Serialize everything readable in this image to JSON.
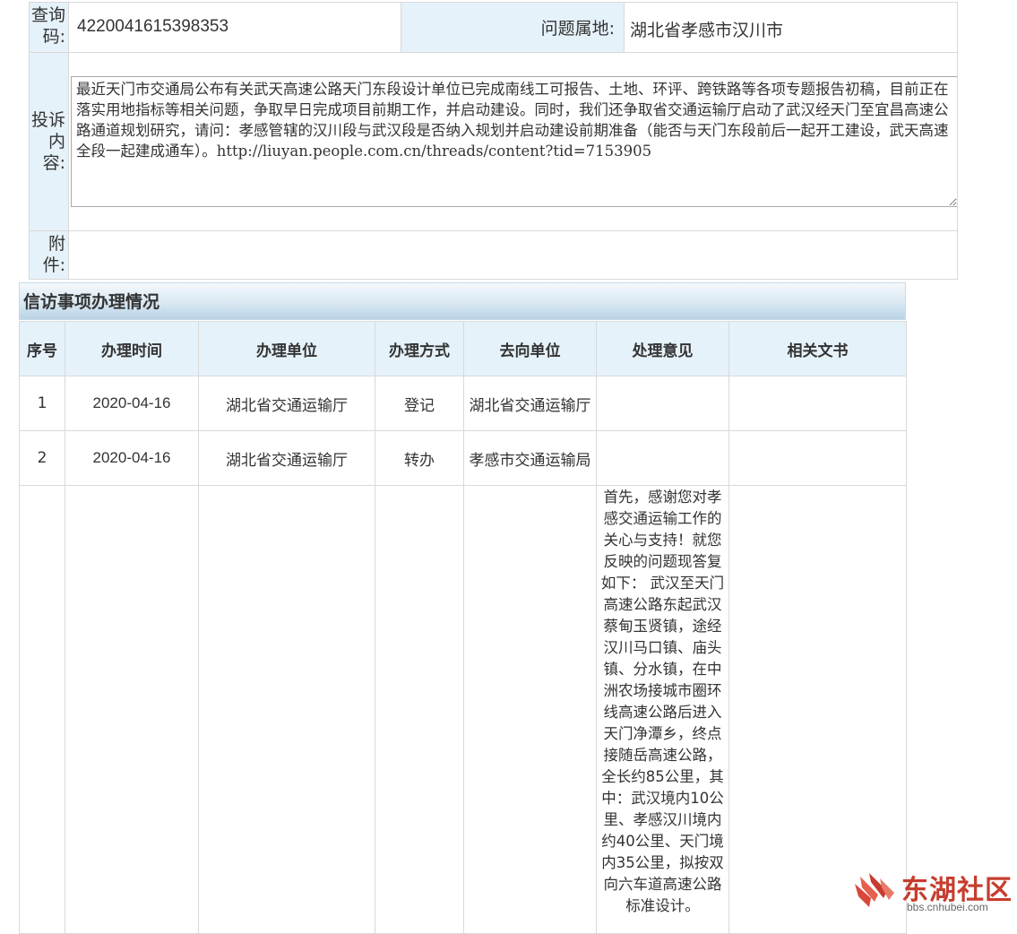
{
  "info": {
    "query_code_label": "查询码:",
    "query_code": "4220041615398353",
    "region_label": "问题属地:",
    "region": "湖北省孝感市汉川市",
    "content_label": "投诉内容:",
    "content": "最近天门市交通局公布有关武天高速公路天门东段设计单位已完成南线工可报告、土地、环评、跨铁路等各项专题报告初稿，目前正在落实用地指标等相关问题，争取早日完成项目前期工作，并启动建设。同时，我们还争取省交通运输厅启动了武汉经天门至宜昌高速公路通道规划研究，请问：孝感管辖的汉川段与武汉段是否纳入规划并启动建设前期准备（能否与天门东段前后一起开工建设，武天高速全段一起建成通车）。http://liuyan.people.com.cn/threads/content?tid=7153905",
    "attachment_label": "附件:"
  },
  "section": {
    "title": "信访事项办理情况"
  },
  "process_table": {
    "headers": [
      "序号",
      "办理时间",
      "办理单位",
      "办理方式",
      "去向单位",
      "处理意见",
      "相关文书"
    ],
    "rows": [
      {
        "no": "1",
        "date": "2020-04-16",
        "unit": "湖北省交通运输厅",
        "method": "登记",
        "target": "湖北省交通运输厅",
        "opinion": "",
        "docs": ""
      },
      {
        "no": "2",
        "date": "2020-04-16",
        "unit": "湖北省交通运输厅",
        "method": "转办",
        "target": "孝感市交通运输局",
        "opinion": "",
        "docs": ""
      },
      {
        "no": "",
        "date": "",
        "unit": "",
        "method": "",
        "target": "",
        "opinion": "首先，感谢您对孝感交通运输工作的关心与支持！就您反映的问题现答复如下： 武汉至天门高速公路东起武汉蔡甸玉贤镇，途经汉川马口镇、庙头镇、分水镇，在中洲农场接城市圈环线高速公路后进入天门净潭乡，终点接随岳高速公路，全长约85公里，其中：武汉境内10公里、孝感汉川境内约40公里、天门境内35公里，拟按双向六车道高速公路标准设计。",
        "docs": ""
      }
    ]
  },
  "watermark": {
    "brand": "东湖社区",
    "site": "bbs.cnhubei.com",
    "color": "#c63d2e"
  }
}
